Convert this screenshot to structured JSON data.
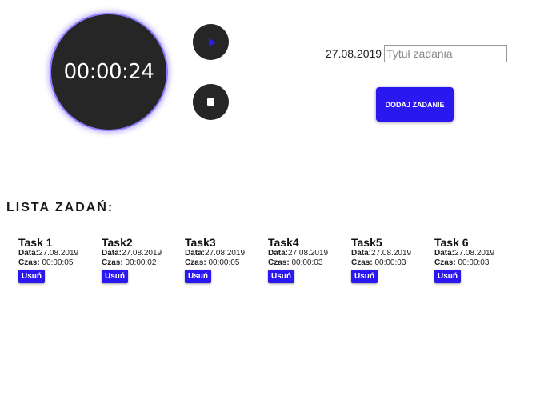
{
  "timer": {
    "display": "00:00:24"
  },
  "controls": {
    "play_icon": "play-icon",
    "stop_icon": "stop-icon",
    "accent_color": "#2b17f0"
  },
  "form": {
    "date": "27.08.2019",
    "title_placeholder": "Tytuł zadania",
    "title_value": "",
    "add_button_label": "DODAJ ZADANIE"
  },
  "list": {
    "heading": "LISTA ZADAŃ:",
    "date_label": "Data:",
    "time_label": "Czas:",
    "delete_label": "Usuń",
    "tasks": [
      {
        "title": "Task 1",
        "date": "27.08.2019",
        "time": "00:00:05"
      },
      {
        "title": "Task2",
        "date": "27.08.2019",
        "time": "00:00:02"
      },
      {
        "title": "Task3",
        "date": "27.08.2019",
        "time": "00:00:05"
      },
      {
        "title": "Task4",
        "date": "27.08.2019",
        "time": "00:00:03"
      },
      {
        "title": "Task5",
        "date": "27.08.2019",
        "time": "00:00:03"
      },
      {
        "title": "Task 6",
        "date": "27.08.2019",
        "time": "00:00:03"
      }
    ]
  }
}
